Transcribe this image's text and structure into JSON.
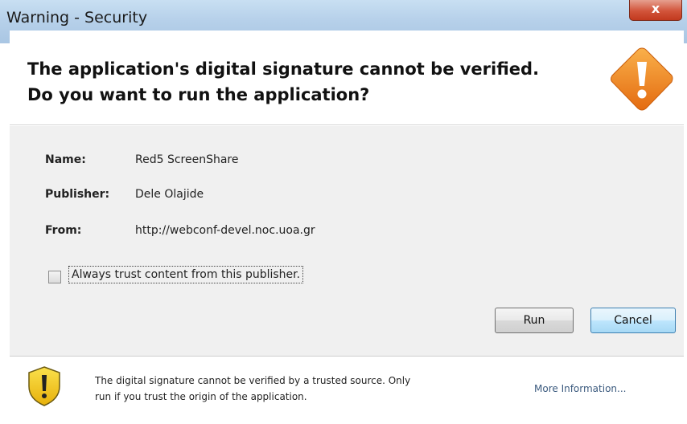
{
  "window": {
    "title": "Warning - Security",
    "close_label": "x"
  },
  "header": {
    "headline_line1": "The application's digital signature cannot be verified.",
    "headline_line2": "Do you want to run the application?",
    "warning_icon": "warning-diamond-icon",
    "warning_icon_color": "#f08a24"
  },
  "details": {
    "name_label": "Name:",
    "name_value": "Red5 ScreenShare",
    "publisher_label": "Publisher:",
    "publisher_value": "Dele Olajide",
    "from_label": "From:",
    "from_value": "http://webconf-devel.noc.uoa.gr"
  },
  "trust_checkbox": {
    "label": "Always trust content from this publisher.",
    "checked": false
  },
  "buttons": {
    "run": "Run",
    "cancel": "Cancel"
  },
  "footer": {
    "shield_icon": "security-shield-icon",
    "shield_color": "#f2c816",
    "text_line1": "The digital signature cannot be verified by a trusted source.  Only",
    "text_line2": "run if you trust the origin of the application.",
    "more_info": "More Information...",
    "link_color": "#3b5a7e"
  }
}
